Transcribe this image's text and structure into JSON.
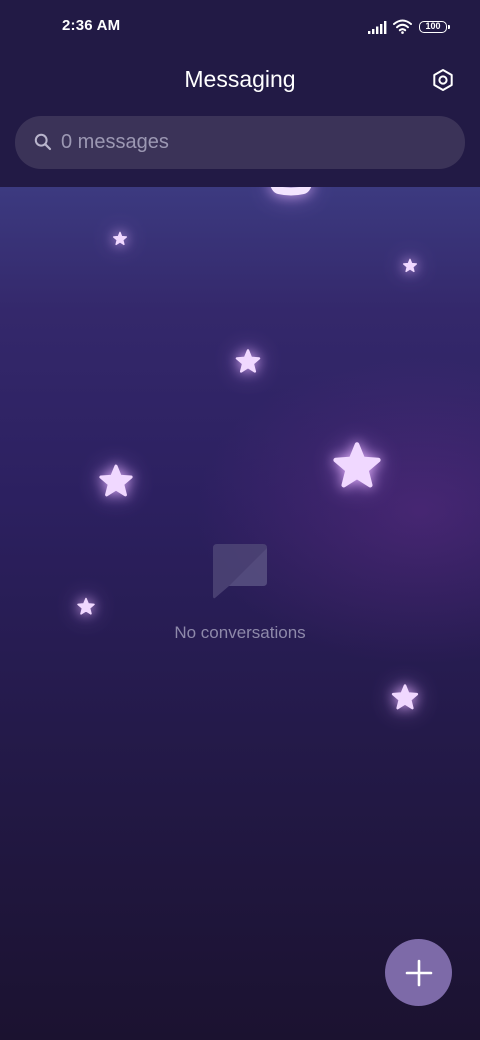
{
  "status_bar": {
    "time": "2:36 AM",
    "battery_level": "100",
    "signal_icon": "cellular-signal-icon",
    "wifi_icon": "wifi-icon"
  },
  "header": {
    "title": "Messaging",
    "settings_icon": "gear-icon"
  },
  "search": {
    "placeholder": "0 messages",
    "icon": "search-icon"
  },
  "empty_state": {
    "icon": "chat-bubble-icon",
    "label": "No conversations"
  },
  "fab": {
    "icon": "plus-icon"
  },
  "colors": {
    "header_background": "#221a45",
    "search_background": "#3b3358",
    "fab_background": "#7d6aa8",
    "star_fill": "#f0d8ff",
    "empty_text": "#8e89aa"
  }
}
